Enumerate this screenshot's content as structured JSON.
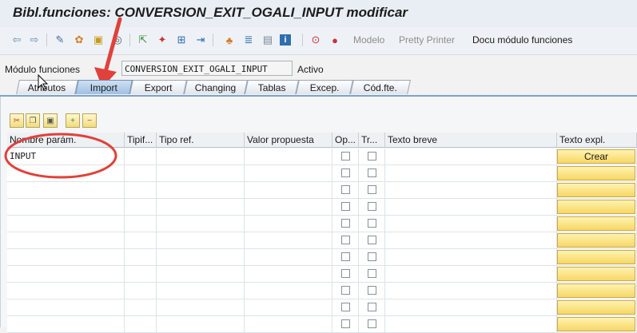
{
  "window": {
    "title": "Bibl.funciones: CONVERSION_EXIT_OGALI_INPUT modificar"
  },
  "toolbar": {
    "icons": [
      "back-icon",
      "forward-icon",
      "display-change-icon",
      "other-object-icon",
      "activate-icon",
      "where-used-icon",
      "object-list-icon",
      "navigate-icon",
      "enhance-icon",
      "insert-icon",
      "test-icon",
      "hierarchy-icon",
      "stack-icon",
      "info-icon",
      "breakpoint-icon",
      "session-breakpoint-icon"
    ],
    "modelo": "Modelo",
    "pretty_printer": "Pretty Printer",
    "docu": "Docu módulo funciones"
  },
  "module": {
    "label": "Módulo funciones",
    "value": "CONVERSION_EXIT_OGALI_INPUT",
    "status": "Activo"
  },
  "tabs": [
    {
      "label": "Atributos",
      "active": false
    },
    {
      "label": "Import",
      "active": true
    },
    {
      "label": "Export",
      "active": false
    },
    {
      "label": "Changing",
      "active": false
    },
    {
      "label": "Tablas",
      "active": false
    },
    {
      "label": "Excep.",
      "active": false
    },
    {
      "label": "Cód.fte.",
      "active": false
    }
  ],
  "table_toolbar": [
    "cut-icon",
    "copy-icon",
    "paste-icon",
    "insert-row-icon",
    "delete-row-icon"
  ],
  "grid": {
    "columns": [
      "Nombre parám.",
      "Tipif...",
      "Tipo ref.",
      "Valor propuesta",
      "Op...",
      "Tr...",
      "Texto breve",
      "Texto expl."
    ],
    "rows": [
      {
        "name": "INPUT",
        "button": "Crear"
      },
      {
        "name": "",
        "button": ""
      },
      {
        "name": "",
        "button": ""
      },
      {
        "name": "",
        "button": ""
      },
      {
        "name": "",
        "button": ""
      },
      {
        "name": "",
        "button": ""
      },
      {
        "name": "",
        "button": ""
      },
      {
        "name": "",
        "button": ""
      },
      {
        "name": "",
        "button": ""
      },
      {
        "name": "",
        "button": ""
      },
      {
        "name": "",
        "button": ""
      }
    ]
  },
  "colors": {
    "annotation": "#e0413b",
    "tab_active": "#9fc0e2",
    "button_yellow": "#f7d765"
  }
}
